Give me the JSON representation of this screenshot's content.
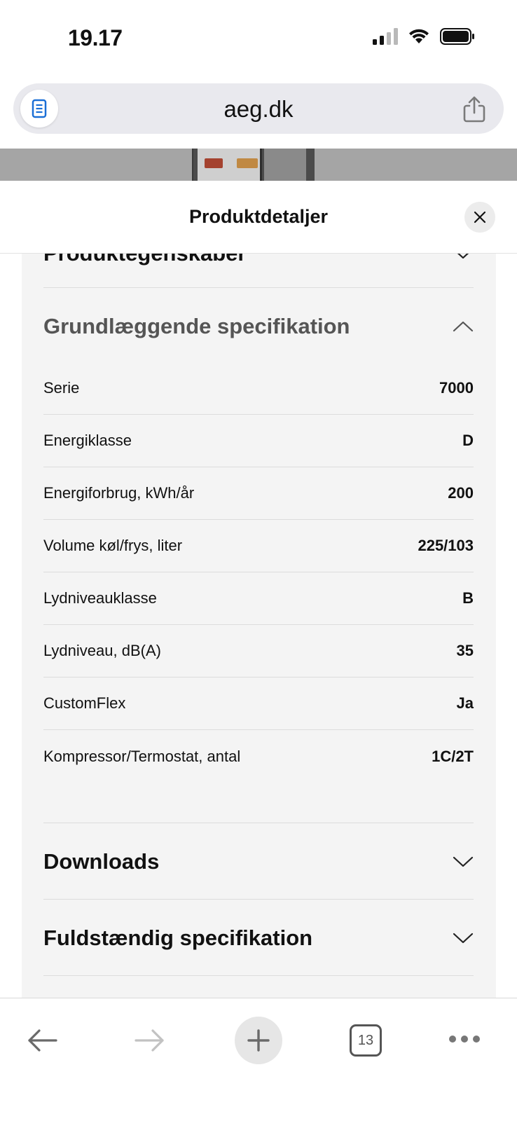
{
  "status_bar": {
    "time": "19.17"
  },
  "browser": {
    "url": "aeg.dk",
    "tab_count": "13"
  },
  "sheet": {
    "title": "Produktdetaljer"
  },
  "sections": {
    "product_features": {
      "title": "Produktegenskaber",
      "expanded": false
    },
    "basic_spec": {
      "title": "Grundlæggende specifikation",
      "expanded": true,
      "rows": [
        {
          "label": "Serie",
          "value": "7000"
        },
        {
          "label": "Energiklasse",
          "value": "D"
        },
        {
          "label": "Energiforbrug, kWh/år",
          "value": "200"
        },
        {
          "label": "Volume køl/frys, liter",
          "value": "225/103"
        },
        {
          "label": "Lydniveauklasse",
          "value": "B"
        },
        {
          "label": "Lydniveau, dB(A)",
          "value": "35"
        },
        {
          "label": "CustomFlex",
          "value": "Ja"
        },
        {
          "label": "Kompressor/Termostat, antal",
          "value": "1C/2T"
        }
      ]
    },
    "downloads": {
      "title": "Downloads",
      "expanded": false
    },
    "full_spec": {
      "title": "Fuldstændig specifikation",
      "expanded": false
    }
  },
  "icons": {
    "reader": "reader-icon",
    "share": "share-icon",
    "close": "close-icon",
    "chevron_down": "chevron-down-icon",
    "chevron_up": "chevron-up-icon",
    "back": "back-arrow-icon",
    "forward": "forward-arrow-icon",
    "new_tab": "plus-icon",
    "more": "more-icon"
  },
  "colors": {
    "accent_reader": "#1a6fd6",
    "panel_bg": "#f4f4f4"
  }
}
